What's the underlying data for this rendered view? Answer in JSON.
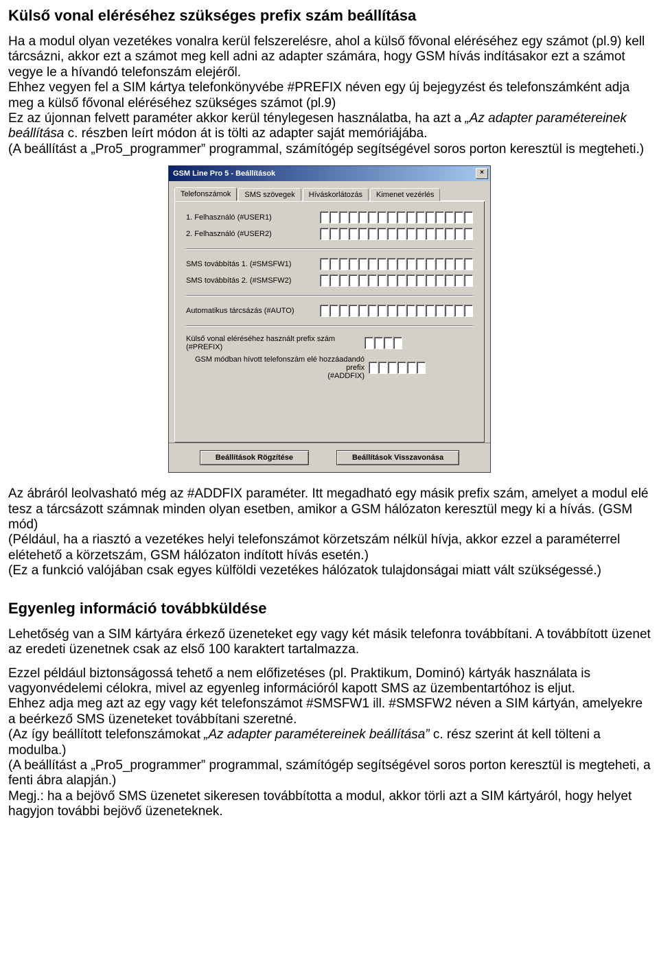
{
  "heading1": "Külső vonal eléréséhez szükséges prefix szám beállítása",
  "p1": "Ha a modul olyan vezetékes vonalra kerül felszerelésre, ahol a külső fővonal eléréséhez egy számot (pl.9) kell tárcsázni, akkor ezt a számot meg kell adni az adapter számára, hogy GSM hívás indításakor ezt a számot vegye le a hívandó telefonszám elejéről.",
  "p2a": "Ehhez vegyen fel a SIM kártya telefonkönyvébe #PREFIX néven egy új bejegyzést és telefonszámként adja meg a külső fővonal eléréséhez szükséges számot (pl.9)",
  "p2b_prefix": "Ez az újonnan felvett paraméter akkor kerül ténylegesen használatba, ha azt a ",
  "p2b_italic": "„Az adapter paramétereinek beállítása ",
  "p2b_suffix": "c. részben leírt módon át is tölti az adapter saját memóriájába.",
  "p3": "(A beállítást a „Pro5_programmer” programmal, számítógép segítségével soros porton keresztül is megteheti.)",
  "window": {
    "title": "GSM Line Pro 5 - Beállítások",
    "close": "×",
    "tabs": [
      "Telefonszámok",
      "SMS szövegek",
      "Híváskorlátozás",
      "Kimenet vezérlés"
    ],
    "rows": {
      "user1": "1. Felhasználó (#USER1)",
      "user2": "2. Felhasználó (#USER2)",
      "smsfw1": "SMS továbbítás 1. (#SMSFW1)",
      "smsfw2": "SMS továbbítás 2. (#SMSFW2)",
      "auto": "Automatikus tárcsázás (#AUTO)",
      "prefix": "Külső vonal eléréséhez használt prefix szám (#PREFIX)",
      "addfix1": "GSM módban hívott telefonszám elé hozzáadandó prefix",
      "addfix2": "(#ADDFIX)"
    },
    "btn_save": "Beállítások Rögzítése",
    "btn_revert": "Beállítások Visszavonása"
  },
  "p4": "Az ábráról leolvasható még az #ADDFIX paraméter. Itt megadható egy másik prefix szám, amelyet a modul elé tesz a tárcsázott számnak minden olyan esetben, amikor a GSM hálózaton keresztül megy ki a hívás. (GSM mód)",
  "p5": "(Például, ha a riasztó a vezetékes helyi telefonszámot körzetszám nélkül hívja, akkor ezzel a paraméterrel elétehető a körzetszám, GSM hálózaton indított hívás esetén.)",
  "p6": "(Ez a funkció valójában csak egyes külföldi vezetékes hálózatok tulajdonságai miatt vált szükségessé.)",
  "heading2": "Egyenleg információ továbbküldése",
  "p7": "Lehetőség van a SIM kártyára érkező üzeneteket egy vagy két másik telefonra továbbítani. A továbbított üzenet az eredeti üzenetnek csak az első 100 karaktert tartalmazza.",
  "p8": "Ezzel például biztonságossá tehető a nem előfizetéses (pl. Praktikum, Dominó) kártyák használata is vagyonvédelemi célokra, mivel az egyenleg információról kapott SMS az üzembentartóhoz is eljut.",
  "p9": "Ehhez adja meg azt az egy vagy két telefonszámot #SMSFW1 ill. #SMSFW2 néven a SIM kártyán, amelyekre a beérkező SMS üzeneteket továbbítani szeretné.",
  "p10a": "(Az így beállított telefonszámokat ",
  "p10b": "„Az adapter paramétereinek beállítása” ",
  "p10c": "c. rész szerint át kell tölteni a modulba.)",
  "p11": "(A beállítást a „Pro5_programmer” programmal, számítógép segítségével soros porton keresztül is megteheti, a fenti ábra alapján.)",
  "p12": "Megj.: ha a bejövő SMS üzenetet sikeresen továbbította a modul, akkor törli azt a SIM kártyáról, hogy helyet hagyjon további bejövő üzeneteknek."
}
